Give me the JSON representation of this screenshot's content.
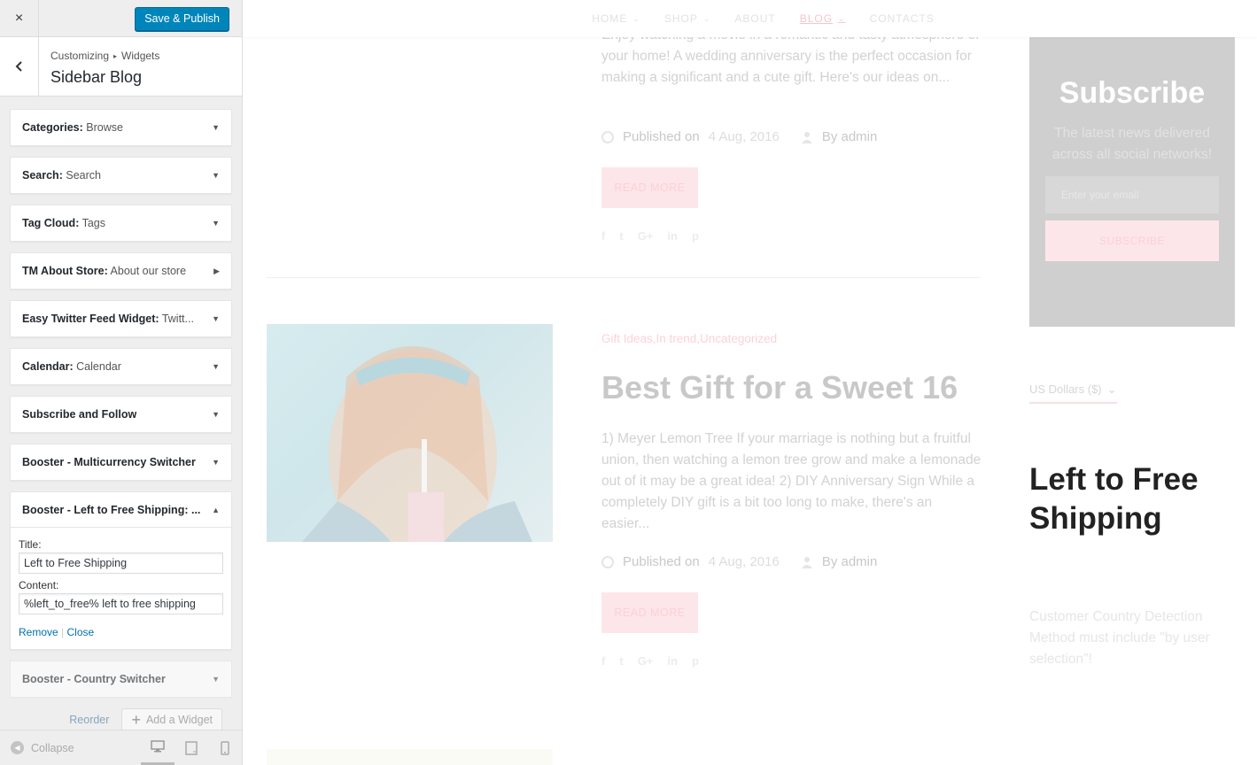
{
  "customizer": {
    "close_icon": "×",
    "publish_label": "Save & Publish",
    "breadcrumb": [
      "Customizing",
      "Widgets"
    ],
    "breadcrumb_sep": "▸",
    "section_title": "Sidebar Blog",
    "widgets": [
      {
        "name": "Categories",
        "sub": "Browse",
        "arrow": "▼"
      },
      {
        "name": "Search",
        "sub": "Search",
        "arrow": "▼"
      },
      {
        "name": "Tag Cloud",
        "sub": "Tags",
        "arrow": "▼"
      },
      {
        "name": "TM About Store",
        "sub": "About our store",
        "arrow": "▶"
      },
      {
        "name": "Easy Twitter Feed Widget",
        "sub": "Twitt...",
        "arrow": "▼"
      },
      {
        "name": "Calendar",
        "sub": "Calendar",
        "arrow": "▼"
      },
      {
        "name": "Subscribe and Follow",
        "sub": "",
        "arrow": "▼"
      },
      {
        "name": "Booster - Multicurrency Switcher",
        "sub": "",
        "arrow": "▼"
      },
      {
        "name": "Booster - Left to Free Shipping: ...",
        "sub": "",
        "arrow": "▲"
      },
      {
        "name": "Booster - Country Switcher",
        "sub": "",
        "arrow": "▼"
      }
    ],
    "open_widget": {
      "title_label": "Title:",
      "title_value": "Left to Free Shipping",
      "content_label": "Content:",
      "content_value": "%left_to_free% left to free shipping",
      "remove_label": "Remove",
      "action_sep": "|",
      "close_label": "Close"
    },
    "reorder_label": "Reorder",
    "add_widget_label": "Add a Widget",
    "add_icon": "+",
    "collapse_label": "Collapse",
    "collapse_icon": "◀"
  },
  "preview": {
    "nav": [
      {
        "label": "HOME",
        "chevron": "⌄"
      },
      {
        "label": "SHOP",
        "chevron": "⌄"
      },
      {
        "label": "ABOUT",
        "chevron": ""
      },
      {
        "label": "BLOG",
        "chevron": "⌄"
      },
      {
        "label": "CONTACTS",
        "chevron": ""
      }
    ],
    "post1": {
      "excerpt": "Enjoy watching a movie in a romantic and tasty atmosphere of your home! A wedding anniversary is the perfect occasion for making a significant and a cute gift. Here's our ideas on...",
      "published_label": "Published on",
      "date": "4 Aug, 2016",
      "author": "By admin",
      "read_more": "READ MORE"
    },
    "post2": {
      "categories": "Gift Ideas,In trend,Uncategorized",
      "title": "Best Gift for a Sweet 16",
      "excerpt": "1) Meyer Lemon Tree If your marriage is nothing but a fruitful union, then watching a lemon tree grow and make a lemonade out of it may be a great idea! 2) DIY Anniversary Sign While a completely DIY gift is a bit too long to make, there's an easier...",
      "published_label": "Published on",
      "date": "4 Aug, 2016",
      "author": "By admin",
      "read_more": "READ MORE"
    },
    "social_icons": [
      "f",
      "t",
      "G+",
      "in",
      "p"
    ],
    "subscribe": {
      "title": "Subscribe",
      "text": "The latest news delivered across all social networks!",
      "placeholder": "Enter your email",
      "button": "SUBSCRIBE"
    },
    "currency": "US Dollars ($)",
    "currency_chevron": "⌄",
    "free_shipping_title": "Left to Free Shipping",
    "free_shipping_content": "Customer Country Detection Method must include \"by user selection\"!"
  },
  "colors": {
    "primary_button": "#0085ba",
    "accent_pink": "#fbd0d6",
    "subscribe_bg": "#cfcfcf"
  }
}
